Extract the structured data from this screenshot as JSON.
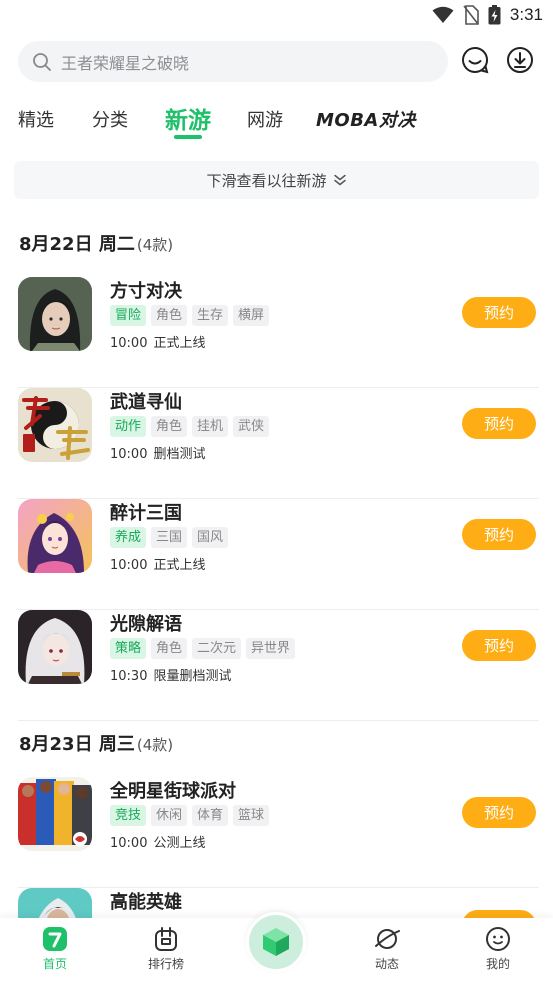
{
  "status_bar": {
    "time": "3:31",
    "icons": [
      "wifi-icon",
      "no-sim-icon",
      "battery-charging-icon"
    ]
  },
  "search": {
    "placeholder": "王者荣耀星之破晓"
  },
  "top_actions": [
    "message-icon",
    "download-icon"
  ],
  "tabs": [
    {
      "label": "精选",
      "active": false
    },
    {
      "label": "分类",
      "active": false
    },
    {
      "label": "新游",
      "active": true
    },
    {
      "label": "网游",
      "active": false
    },
    {
      "label": "MOBA对决",
      "active": false
    }
  ],
  "hint": {
    "text": "下滑查看以往新游"
  },
  "sections": [
    {
      "date": "8月22日 周二",
      "count": "(4款)",
      "games": [
        {
          "title": "方寸对决",
          "tags": [
            "冒险",
            "角色",
            "生存",
            "横屏"
          ],
          "time": "10:00",
          "status": "正式上线",
          "button": "预约"
        },
        {
          "title": "武道寻仙",
          "tags": [
            "动作",
            "角色",
            "挂机",
            "武侠"
          ],
          "time": "10:00",
          "status": "删档测试",
          "button": "预约"
        },
        {
          "title": "醉计三国",
          "tags": [
            "养成",
            "三国",
            "国风"
          ],
          "time": "10:00",
          "status": "正式上线",
          "button": "预约"
        },
        {
          "title": "光隙解语",
          "tags": [
            "策略",
            "角色",
            "二次元",
            "异世界"
          ],
          "time": "10:30",
          "status": "限量删档测试",
          "button": "预约"
        }
      ]
    },
    {
      "date": "8月23日 周三",
      "count": "(4款)",
      "games": [
        {
          "title": "全明星街球派对",
          "tags": [
            "竞技",
            "休闲",
            "体育",
            "篮球"
          ],
          "time": "10:00",
          "status": "公测上线",
          "button": "预约"
        },
        {
          "title": "高能英雄",
          "tags": [],
          "time": "",
          "status": "",
          "button": ""
        }
      ]
    }
  ],
  "bottom_nav": [
    {
      "label": "首页",
      "icon": "home-icon",
      "active": true
    },
    {
      "label": "排行榜",
      "icon": "ranking-icon",
      "active": false
    },
    {
      "label": "",
      "icon": "cube-icon",
      "active": false
    },
    {
      "label": "动态",
      "icon": "planet-icon",
      "active": false
    },
    {
      "label": "我的",
      "icon": "profile-icon",
      "active": false
    }
  ],
  "colors": {
    "accent": "#1ec06a",
    "reserve": "#ffad14",
    "tag_primary_bg": "#d9f6e4"
  }
}
